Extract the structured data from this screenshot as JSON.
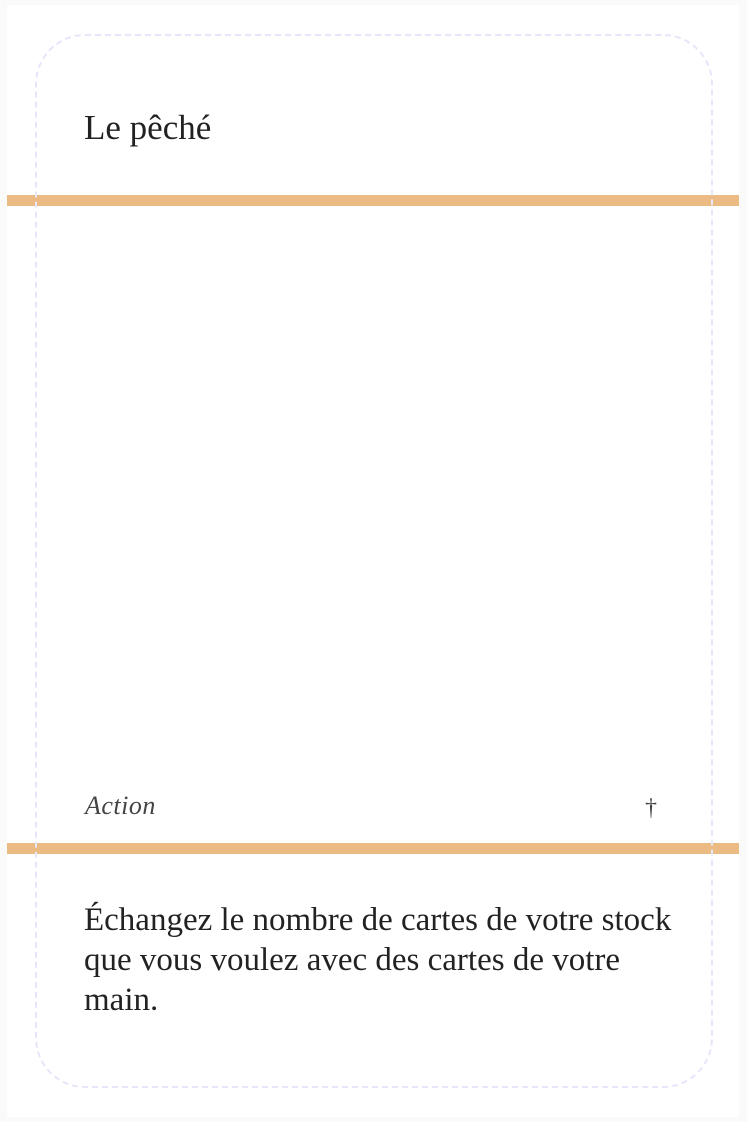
{
  "card": {
    "title": "Le pêché",
    "type": "Action",
    "cost_symbol": "†",
    "text": "Échangez le nombre de cartes de votre stock que vous voulez avec des cartes de votre main.",
    "accent_color": "#ecbb83",
    "safe_zone_color": "#e6e6fa"
  }
}
